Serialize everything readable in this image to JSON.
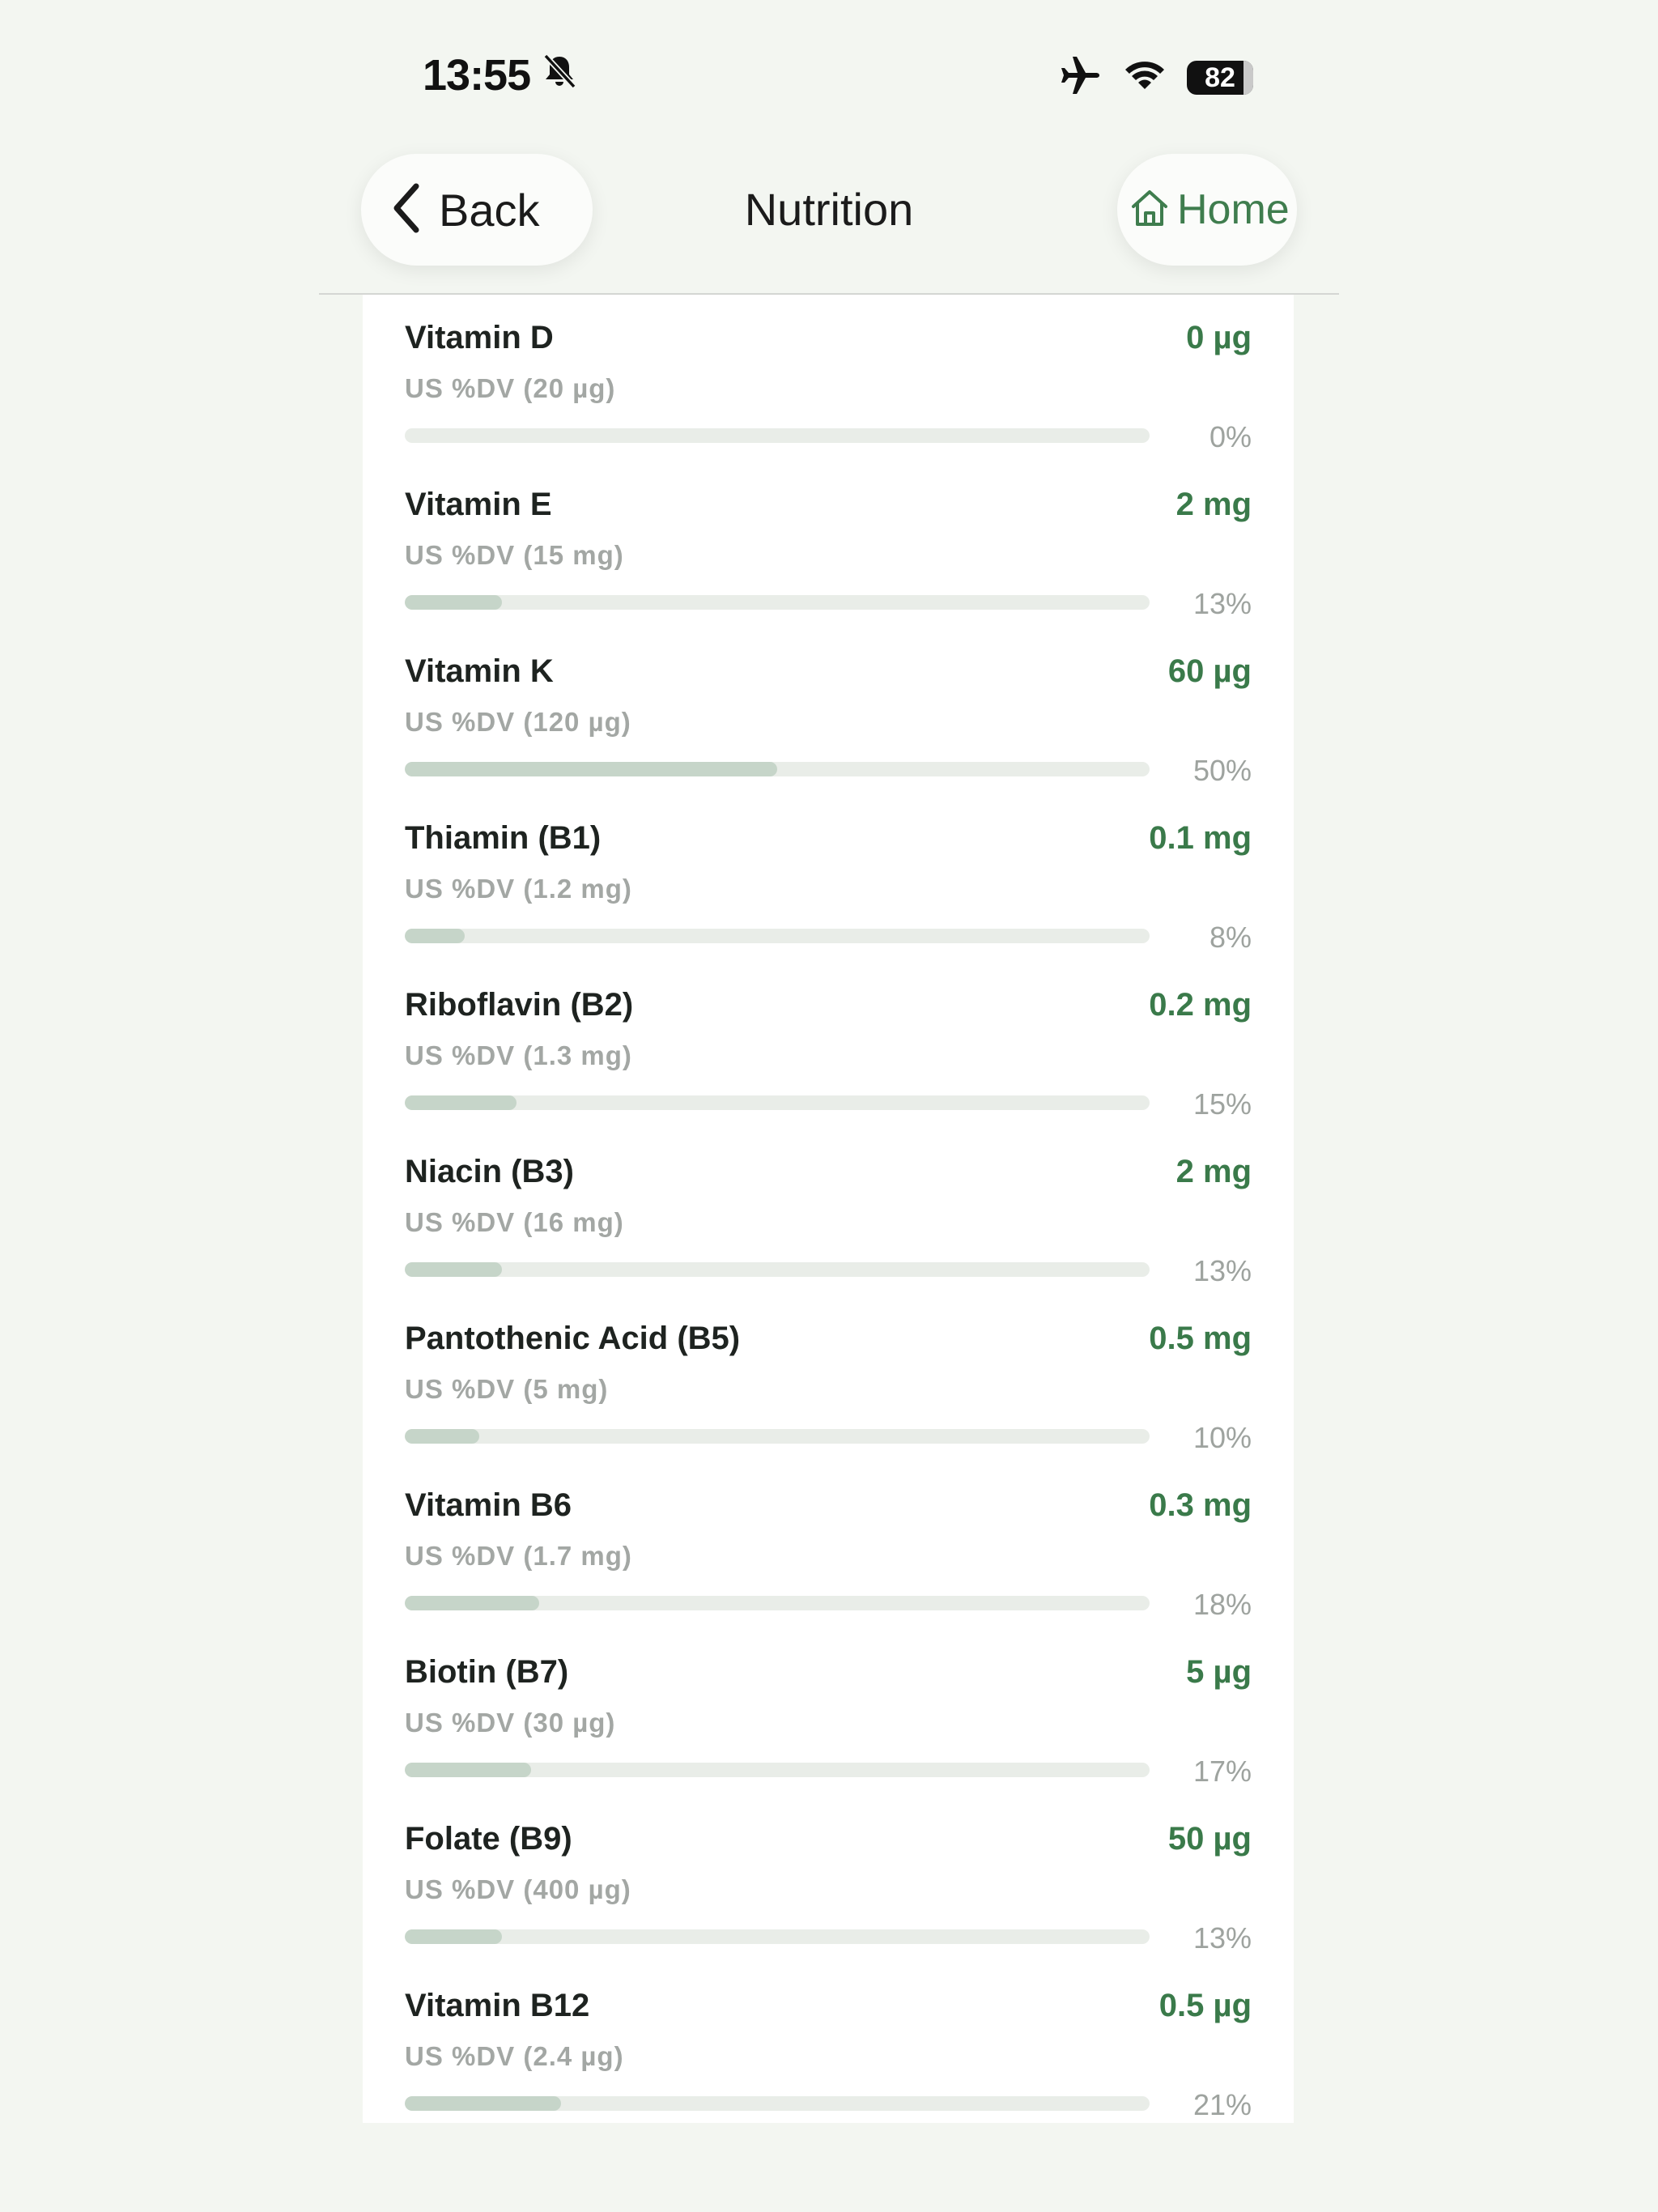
{
  "status_bar": {
    "time": "13:55",
    "battery": "82"
  },
  "header": {
    "back_label": "Back",
    "title": "Nutrition",
    "home_label": "Home"
  },
  "colors": {
    "accent": "#3a7a4a",
    "bar_fill": "#c6d5c9",
    "bar_track": "#e9ede8",
    "background": "#f3f6f1"
  },
  "nutrients": [
    {
      "name": "Vitamin D",
      "amount": "0 µg",
      "dv": "US %DV (20 µg)",
      "percent_label": "0%",
      "percent": 0
    },
    {
      "name": "Vitamin E",
      "amount": "2 mg",
      "dv": "US %DV (15 mg)",
      "percent_label": "13%",
      "percent": 13
    },
    {
      "name": "Vitamin K",
      "amount": "60 µg",
      "dv": "US %DV (120 µg)",
      "percent_label": "50%",
      "percent": 50
    },
    {
      "name": "Thiamin (B1)",
      "amount": "0.1 mg",
      "dv": "US %DV (1.2 mg)",
      "percent_label": "8%",
      "percent": 8
    },
    {
      "name": "Riboflavin (B2)",
      "amount": "0.2 mg",
      "dv": "US %DV (1.3 mg)",
      "percent_label": "15%",
      "percent": 15
    },
    {
      "name": "Niacin (B3)",
      "amount": "2 mg",
      "dv": "US %DV (16 mg)",
      "percent_label": "13%",
      "percent": 13
    },
    {
      "name": "Pantothenic Acid (B5)",
      "amount": "0.5 mg",
      "dv": "US %DV (5 mg)",
      "percent_label": "10%",
      "percent": 10
    },
    {
      "name": "Vitamin B6",
      "amount": "0.3 mg",
      "dv": "US %DV (1.7 mg)",
      "percent_label": "18%",
      "percent": 18
    },
    {
      "name": "Biotin (B7)",
      "amount": "5 µg",
      "dv": "US %DV (30 µg)",
      "percent_label": "17%",
      "percent": 17
    },
    {
      "name": "Folate (B9)",
      "amount": "50 µg",
      "dv": "US %DV (400 µg)",
      "percent_label": "13%",
      "percent": 13
    },
    {
      "name": "Vitamin B12",
      "amount": "0.5 µg",
      "dv": "US %DV (2.4 µg)",
      "percent_label": "21%",
      "percent": 21
    }
  ]
}
